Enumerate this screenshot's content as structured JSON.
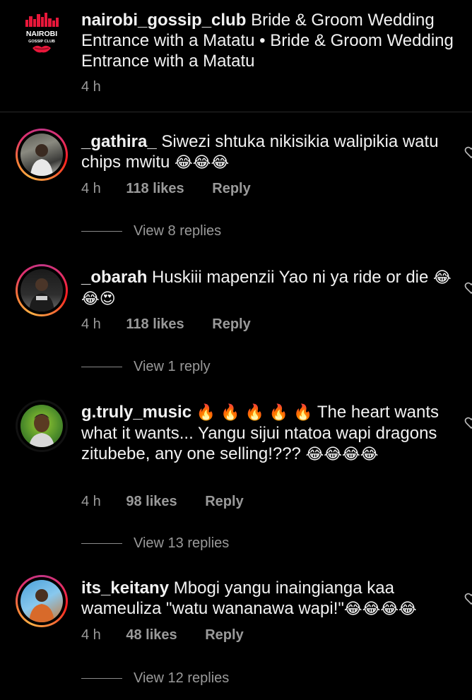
{
  "caption": {
    "avatar_name": "NAIROBI",
    "avatar_sub": "GOSSIP CLUB",
    "username": "nairobi_gossip_club",
    "text": "Bride & Groom Wedding Entrance with a Matatu • Bride & Groom Wedding Entrance with a Matatu",
    "time": "4 h"
  },
  "comments": [
    {
      "username": "_gathira_",
      "text": "Siwezi shtuka nikisikia walipikia watu chips mwitu",
      "emojis": "😂😂😂",
      "time": "4 h",
      "likes": "118 likes",
      "reply": "Reply",
      "view_replies": "View 8 replies"
    },
    {
      "username": "_obarah",
      "text": "Huskiii mapenzii Yao ni ya ride or die",
      "emojis": "😂😂😍",
      "time": "4 h",
      "likes": "118 likes",
      "reply": "Reply",
      "view_replies": "View 1 reply"
    },
    {
      "username": "g.truly_music",
      "fire": "🔥 🔥 🔥 🔥 🔥",
      "text": "The heart wants what it wants... Yangu sijui ntatoa wapi dragons zitubebe, any one selling!???",
      "emojis": "😂😂😂😂",
      "time": "4 h",
      "likes": "98 likes",
      "reply": "Reply",
      "view_replies": "View 13 replies"
    },
    {
      "username": "its_keitany",
      "text": "Mbogi yangu inaingianga kaa wameuliza \"watu wananawa wapi!\"",
      "emojis": "😂😂😂😂",
      "time": "4 h",
      "likes": "48 likes",
      "reply": "Reply",
      "view_replies": "View 12 replies"
    }
  ],
  "icons": {
    "like": "heart-outline-icon"
  },
  "colors": {
    "background": "#000000",
    "muted_text": "#9a9a9a",
    "brand_red": "#e8173a"
  }
}
